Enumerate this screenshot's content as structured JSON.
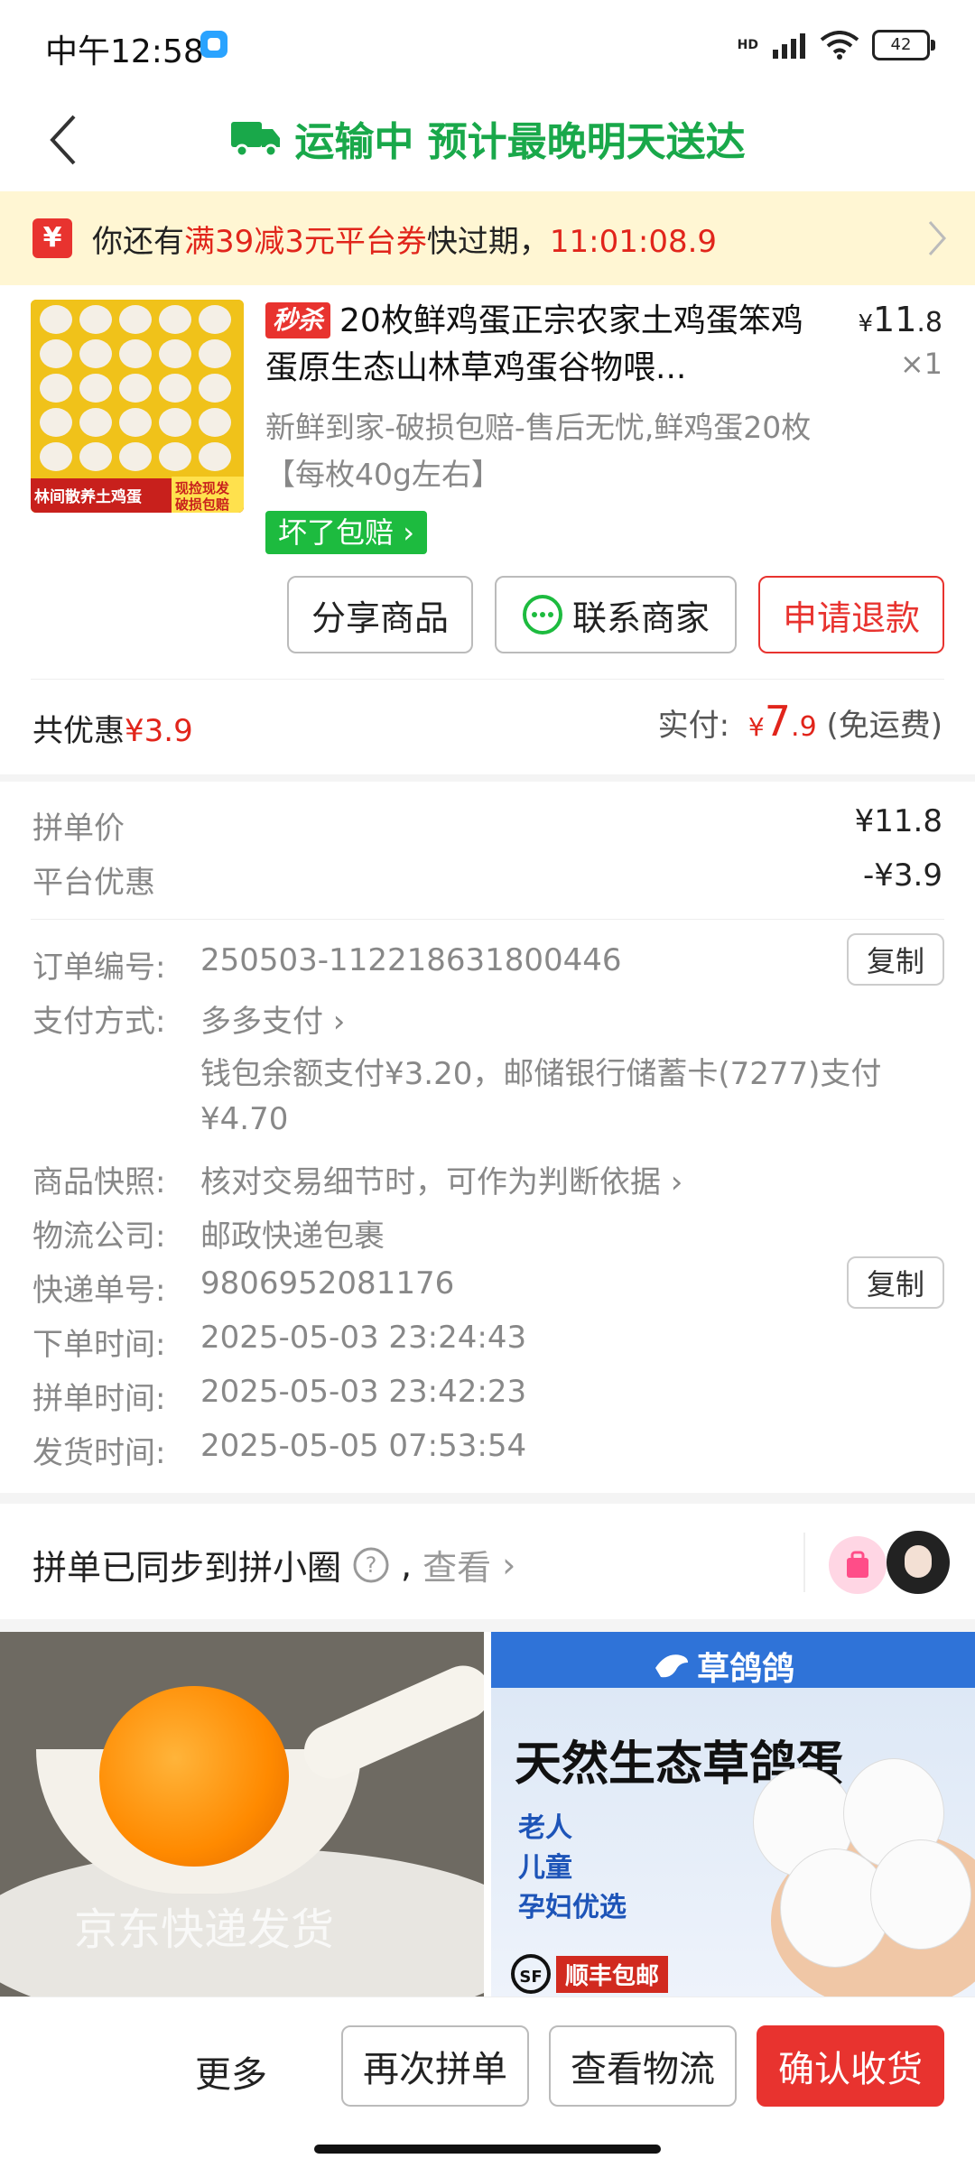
{
  "status": {
    "time": "中午12:58",
    "battery": "42",
    "network": "HD"
  },
  "header": {
    "title": "运输中 预计最晚明天送达"
  },
  "banner": {
    "prefix": "你还有",
    "coupon": "满39减3元平台券",
    "middle": "快过期，",
    "countdown": "11:01:08.9"
  },
  "product": {
    "image_caption": "林间散养土鸡蛋",
    "image_badge_1": "现捡现发",
    "image_badge_2": "破损包赔",
    "tag": "秒杀",
    "title": "20枚鲜鸡蛋正宗农家土鸡蛋笨鸡蛋原生态山林草鸡蛋谷物喂...",
    "price_symbol": "¥",
    "price_int": "11",
    "price_dec": ".8",
    "qty": "×1",
    "subtitle": "新鲜到家-破损包赔-售后无忧,鲜鸡蛋20枚【每枚40g左右】",
    "badge": "坏了包赔"
  },
  "actions": {
    "share": "分享商品",
    "contact": "联系商家",
    "refund": "申请退款"
  },
  "summary": {
    "discount_label": "共优惠",
    "discount_value": "¥3.9",
    "paid_label": "实付:",
    "paid_symbol": "¥",
    "paid_int": "7",
    "paid_dec": ".9",
    "shipping": "(免运费)"
  },
  "prices": [
    {
      "label": "拼单价",
      "value": "¥11.8"
    },
    {
      "label": "平台优惠",
      "value": "-¥3.9"
    }
  ],
  "order": {
    "number_label": "订单编号:",
    "number": "250503-112218631800446",
    "copy": "复制",
    "payment_label": "支付方式:",
    "payment": "多多支付",
    "payment_detail_1": "钱包余额支付¥3.20，邮储银行储蓄卡(7277)支付",
    "payment_detail_2": "¥4.70",
    "snapshot_label": "商品快照:",
    "snapshot": "核对交易细节时，可作为判断依据",
    "logistics_label": "物流公司:",
    "logistics": "邮政快递包裹",
    "tracking_label": "快递单号:",
    "tracking": "9806952081176",
    "order_time_label": "下单时间:",
    "order_time": "2025-05-03 23:24:43",
    "group_time_label": "拼单时间:",
    "group_time": "2025-05-03 23:42:23",
    "ship_time_label": "发货时间:",
    "ship_time": "2025-05-05 07:53:54"
  },
  "circle": {
    "text": "拼单已同步到拼小圈",
    "view": "查看"
  },
  "ads": {
    "left_caption": "京东快递发货",
    "right_brand": "草鸽鸽",
    "right_title": "天然生态草鸽蛋",
    "right_lines": [
      "老人",
      "儿童",
      "孕妇优选"
    ],
    "right_shipping": "顺丰包邮",
    "right_sf": "SF"
  },
  "bottom": {
    "more": "更多",
    "regroup": "再次拼单",
    "logistics": "查看物流",
    "confirm": "确认收货"
  },
  "colors": {
    "brand_green": "#19a84a",
    "accent_red": "#e8332f"
  }
}
